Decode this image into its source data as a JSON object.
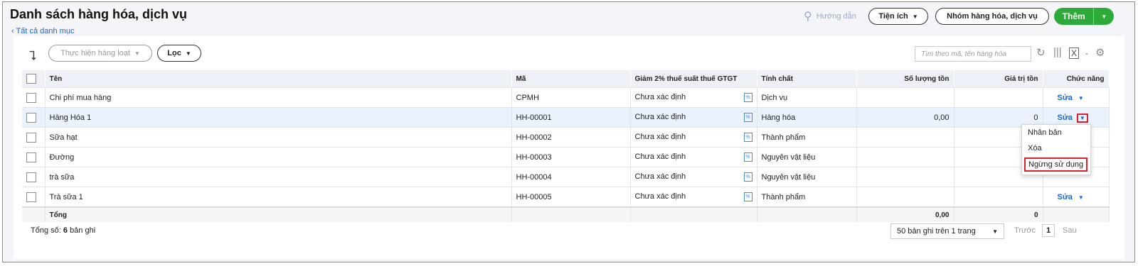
{
  "header": {
    "title": "Danh sách hàng hóa, dịch vụ",
    "back_link": "Tất cả danh mục",
    "help_label": "Hướng dẫn",
    "utilities_label": "Tiện ích",
    "group_label": "Nhóm hàng hóa, dịch vụ",
    "add_label": "Thêm"
  },
  "toolbar": {
    "bulk_label": "Thực hiện hàng loạt",
    "filter_label": "Lọc",
    "search_placeholder": "Tìm theo mã, tên hàng hóa"
  },
  "table": {
    "columns": [
      "Tên",
      "Mã",
      "Giảm 2% thuế suất thuế GTGT",
      "Tính chất",
      "Số lượng tồn",
      "Giá trị tồn",
      "Chức năng"
    ],
    "rows": [
      {
        "name": "Chi phí mua hàng",
        "code": "CPMH",
        "vat": "Chưa xác định",
        "type": "Dịch vụ",
        "qty": "",
        "value": "",
        "action": "Sửa"
      },
      {
        "name": "Hàng Hóa 1",
        "code": "HH-00001",
        "vat": "Chưa xác định",
        "type": "Hàng hóa",
        "qty": "0,00",
        "value": "0",
        "action": "Sửa"
      },
      {
        "name": "Sữa hạt",
        "code": "HH-00002",
        "vat": "Chưa xác định",
        "type": "Thành phẩm",
        "qty": "",
        "value": "",
        "action": ""
      },
      {
        "name": "Đường",
        "code": "HH-00003",
        "vat": "Chưa xác định",
        "type": "Nguyên vật liệu",
        "qty": "",
        "value": "",
        "action": ""
      },
      {
        "name": "trà sữa",
        "code": "HH-00004",
        "vat": "Chưa xác định",
        "type": "Nguyên vật liệu",
        "qty": "",
        "value": "",
        "action": ""
      },
      {
        "name": "Trà sữa 1",
        "code": "HH-00005",
        "vat": "Chưa xác định",
        "type": "Thành phẩm",
        "qty": "",
        "value": "",
        "action": "Sửa"
      }
    ],
    "total": {
      "label": "Tổng",
      "qty": "0,00",
      "value": "0"
    }
  },
  "footer": {
    "total_prefix": "Tổng số:",
    "total_count": "6",
    "total_suffix": "bản ghi",
    "page_size": "50 bản ghi trên 1 trang",
    "prev": "Trước",
    "page": "1",
    "next": "Sau"
  },
  "action_menu": {
    "items": [
      "Nhân bản",
      "Xóa",
      "Ngừng sử dụng"
    ]
  },
  "colors": {
    "accent": "#1565d8",
    "add": "#2dab3a",
    "highlight": "#d7232e"
  }
}
